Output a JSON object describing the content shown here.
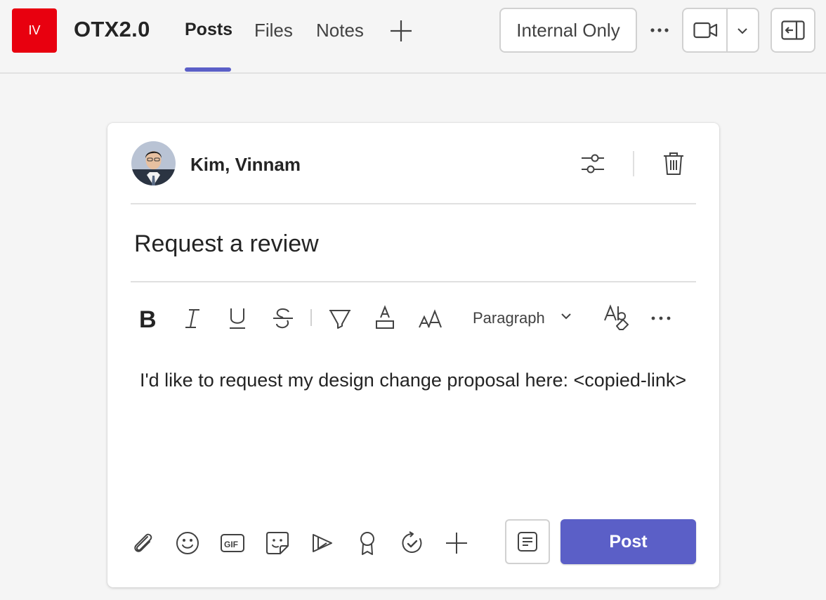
{
  "header": {
    "team_initials": "IV",
    "team_name": "OTX2.0",
    "tabs": [
      {
        "label": "Posts",
        "active": true
      },
      {
        "label": "Files",
        "active": false
      },
      {
        "label": "Notes",
        "active": false
      }
    ],
    "sensitivity_label": "Internal Only",
    "icons": {
      "add_tab": "plus-icon",
      "more": "more-horizontal-icon",
      "meet": "video-camera-icon",
      "meet_dropdown": "chevron-down-icon",
      "side_panel": "panel-left-icon"
    }
  },
  "compose": {
    "author": "Kim, Vinnam",
    "subject": "Request a review",
    "format_toolbar": {
      "paragraph_label": "Paragraph",
      "icons": [
        "bold-icon",
        "italic-icon",
        "underline-icon",
        "strikethrough-icon",
        "highlight-icon",
        "font-color-icon",
        "font-size-icon",
        "chevron-down-icon",
        "clear-formatting-icon",
        "more-horizontal-icon"
      ]
    },
    "message": "I'd like to request my design change proposal here: <copied-link>",
    "bottom_toolbar": {
      "icons": [
        "attach-icon",
        "emoji-icon",
        "gif-icon",
        "sticker-icon",
        "loop-icon",
        "praise-icon",
        "approvals-icon",
        "plus-icon",
        "subject-icon"
      ]
    },
    "post_label": "Post"
  },
  "colors": {
    "accent": "#5b5fc7",
    "team_avatar": "#e8000f",
    "background": "#f5f5f5"
  }
}
